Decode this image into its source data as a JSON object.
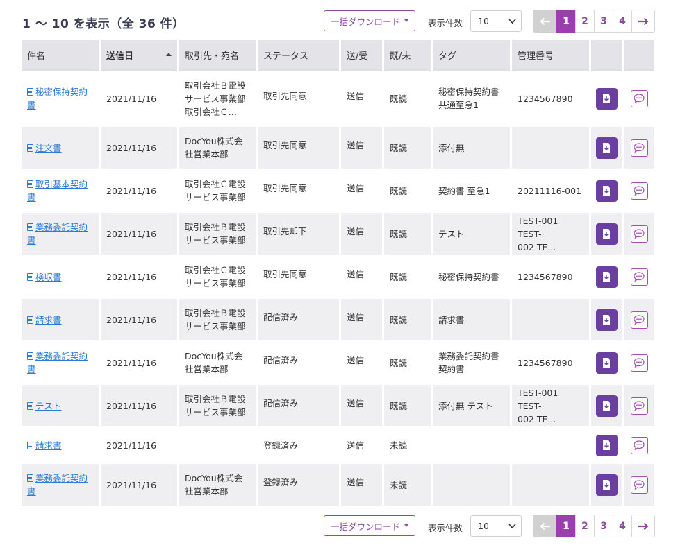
{
  "summary": "1 ～ 10 を表示（全 36 件）",
  "toolbar": {
    "bulk_download": "一括ダウンロード",
    "per_page_label": "表示件数",
    "per_page_value": "10",
    "pages": [
      "1",
      "2",
      "3",
      "4"
    ],
    "current_page": "1"
  },
  "columns": [
    "件名",
    "送信日",
    "取引先・宛名",
    "ステータス",
    "送/受",
    "既/未",
    "タグ",
    "管理番号"
  ],
  "rows": [
    {
      "name1": "秘密保持契約",
      "name2": "書",
      "date": "2021/11/16",
      "partner1": "取引会社Ｂ電設",
      "partner2": "サービス事業部",
      "partner3": "取引会社Ｃ…",
      "status": "取引先同意",
      "direction": "送信",
      "read": "既読",
      "tag1": "秘密保持契約書",
      "tag2": "共通至急1",
      "mgmt1": "1234567890",
      "mgmt2": ""
    },
    {
      "name1": "注文書",
      "name2": "",
      "date": "2021/11/16",
      "partner1": "DocYou株式会",
      "partner2": "社営業本部",
      "partner3": "",
      "status": "取引先同意",
      "direction": "送信",
      "read": "既読",
      "tag1": "添付無",
      "tag2": "",
      "mgmt1": "",
      "mgmt2": ""
    },
    {
      "name1": "取引基本契約",
      "name2": "書",
      "date": "2021/11/16",
      "partner1": "取引会社Ｃ電設",
      "partner2": "サービス事業部",
      "partner3": "",
      "status": "取引先同意",
      "direction": "送信",
      "read": "既読",
      "tag1": "契約書 至急1",
      "tag2": "",
      "mgmt1": "20211116-001",
      "mgmt2": ""
    },
    {
      "name1": "業務委託契約",
      "name2": "書",
      "date": "2021/11/16",
      "partner1": "取引会社Ｂ電設",
      "partner2": "サービス事業部",
      "partner3": "",
      "status": "取引先却下",
      "direction": "送信",
      "read": "既読",
      "tag1": "テスト",
      "tag2": "",
      "mgmt1": "TEST-001 TEST-",
      "mgmt2": "002 TE..."
    },
    {
      "name1": "検収書",
      "name2": "",
      "date": "2021/11/16",
      "partner1": "取引会社Ｃ電設",
      "partner2": "サービス事業部",
      "partner3": "",
      "status": "取引先同意",
      "direction": "送信",
      "read": "既読",
      "tag1": "秘密保持契約書",
      "tag2": "",
      "mgmt1": "1234567890",
      "mgmt2": ""
    },
    {
      "name1": "請求書",
      "name2": "",
      "date": "2021/11/16",
      "partner1": "取引会社Ｂ電設",
      "partner2": "サービス事業部",
      "partner3": "",
      "status": "配信済み",
      "direction": "送信",
      "read": "既読",
      "tag1": "請求書",
      "tag2": "",
      "mgmt1": "",
      "mgmt2": ""
    },
    {
      "name1": "業務委託契約",
      "name2": "書",
      "date": "2021/11/16",
      "partner1": "DocYou株式会",
      "partner2": "社営業本部",
      "partner3": "",
      "status": "配信済み",
      "direction": "送信",
      "read": "既読",
      "tag1": "業務委託契約書",
      "tag2": "契約書",
      "mgmt1": "1234567890",
      "mgmt2": ""
    },
    {
      "name1": "テスト",
      "name2": "",
      "date": "2021/11/16",
      "partner1": "取引会社Ｂ電設",
      "partner2": "サービス事業部",
      "partner3": "",
      "status": "配信済み",
      "direction": "送信",
      "read": "既読",
      "tag1": "添付無 テスト",
      "tag2": "",
      "mgmt1": "TEST-001 TEST-",
      "mgmt2": "002 TE..."
    },
    {
      "name1": "請求書",
      "name2": "",
      "date": "2021/11/16",
      "partner1": "",
      "partner2": "",
      "partner3": "",
      "status": "登録済み",
      "direction": "送信",
      "read": "未読",
      "tag1": "",
      "tag2": "",
      "mgmt1": "",
      "mgmt2": ""
    },
    {
      "name1": "業務委託契約",
      "name2": "書",
      "date": "2021/11/16",
      "partner1": "DocYou株式会",
      "partner2": "社営業本部",
      "partner3": "",
      "status": "登録済み",
      "direction": "送信",
      "read": "未読",
      "tag1": "",
      "tag2": "",
      "mgmt1": "",
      "mgmt2": ""
    }
  ]
}
